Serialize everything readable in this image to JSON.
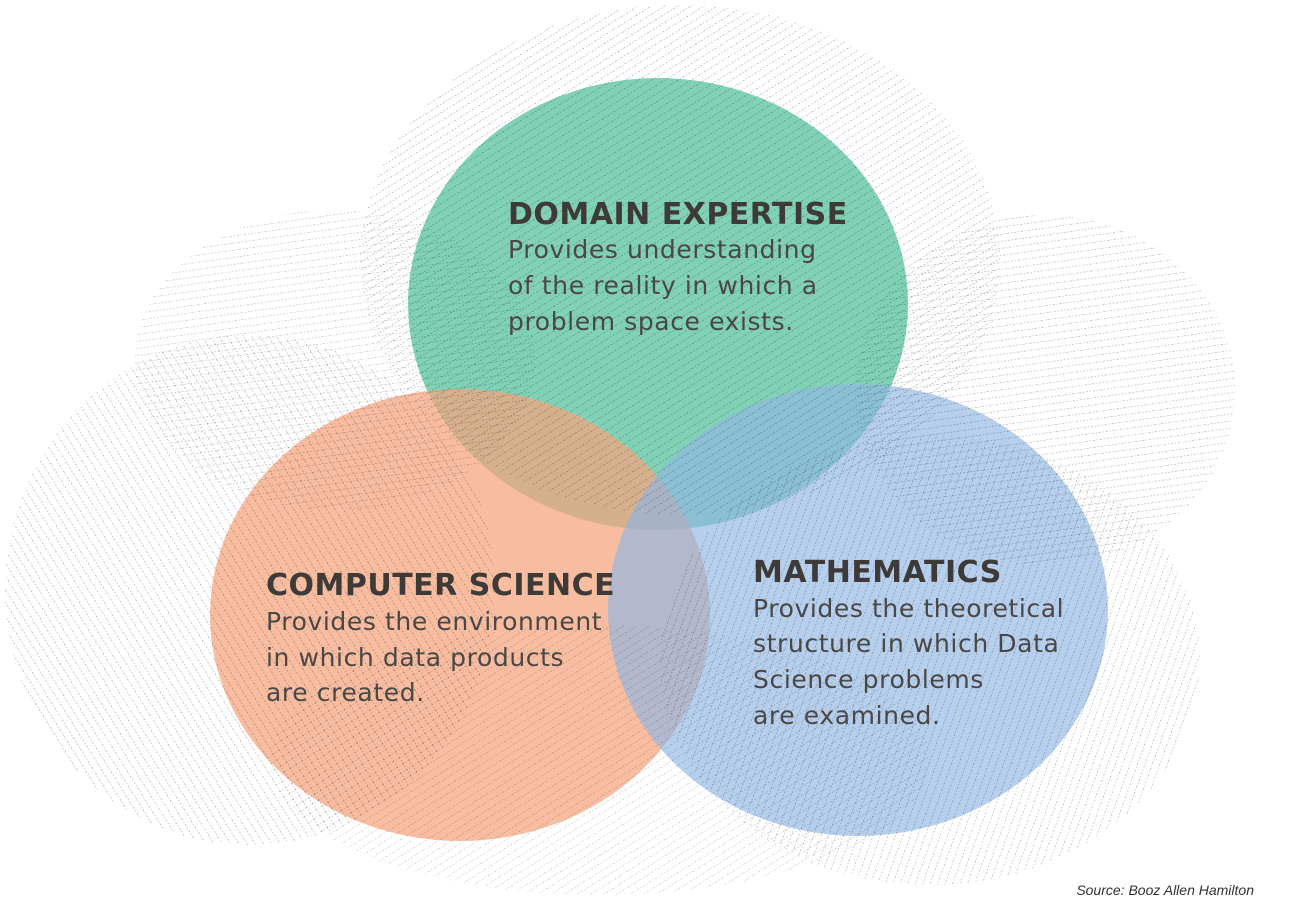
{
  "domain_expertise": {
    "title": "DOMAIN EXPERTISE",
    "lines": [
      "Provides understanding",
      "of the reality in which a",
      "problem space exists."
    ],
    "color": "#4fbf9a"
  },
  "computer_science": {
    "title": "COMPUTER SCIENCE",
    "lines": [
      "Provides the environment",
      "in which data products",
      "are created."
    ],
    "color": "#f5a47c"
  },
  "mathematics": {
    "title": "MATHEMATICS",
    "lines": [
      "Provides the theoretical",
      "structure in which Data",
      "Science problems",
      "are examined."
    ],
    "color": "#8fb6e3"
  },
  "source": "Source: Booz Allen Hamilton",
  "colors": {
    "hatch": "#8a8a8a",
    "text": "#3d3a38"
  }
}
